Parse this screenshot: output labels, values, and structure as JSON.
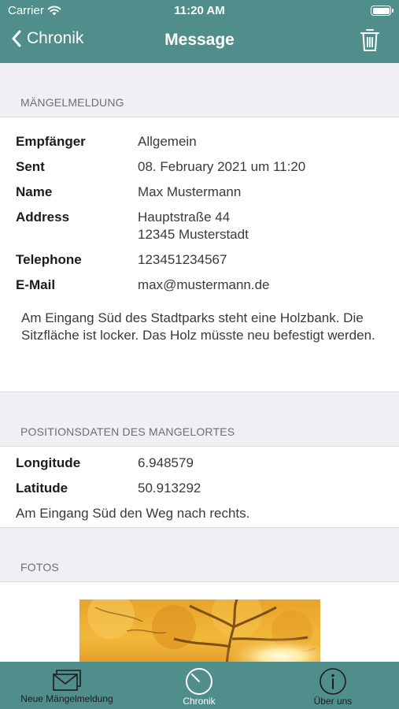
{
  "status_bar": {
    "carrier": "Carrier",
    "time": "11:20 AM",
    "battery_level": 1.0
  },
  "nav": {
    "back_label": "Chronik",
    "title": "Message",
    "trash_icon": "trash-icon"
  },
  "section1": {
    "header": "MÄNGELMELDUNG",
    "rows": [
      {
        "label": "Empfänger",
        "value": "Allgemein"
      },
      {
        "label": "Sent",
        "value": "08. February 2021 um 11:20"
      },
      {
        "label": "Name",
        "value": "Max Mustermann"
      },
      {
        "label": "Address",
        "value": "Hauptstraße 44",
        "value2": "12345 Musterstadt"
      },
      {
        "label": "Telephone",
        "value": "123451234567"
      },
      {
        "label": "E-Mail",
        "value": "max@mustermann.de"
      }
    ],
    "message": "Am Eingang Süd des Stadtparks steht eine Holzbank. Die Sitzfläche ist locker. Das Holz müsste neu befestigt werden."
  },
  "section2": {
    "header": "POSITIONSDATEN DES MANGELORTES",
    "rows": [
      {
        "label": "Longitude",
        "value": "6.948579"
      },
      {
        "label": "Latitude",
        "value": "50.913292"
      }
    ],
    "note": "Am Eingang Süd den Weg nach rechts."
  },
  "section3": {
    "header": "FOTOS"
  },
  "tabbar": {
    "tabs": [
      {
        "label": "Neue Mängelmeldung",
        "icon": "envelope-icon"
      },
      {
        "label": "Chronik",
        "icon": "clock-icon"
      },
      {
        "label": "Über uns",
        "icon": "info-icon"
      }
    ]
  },
  "colors": {
    "accent": "#4f8e8b",
    "background": "#efeff4"
  }
}
